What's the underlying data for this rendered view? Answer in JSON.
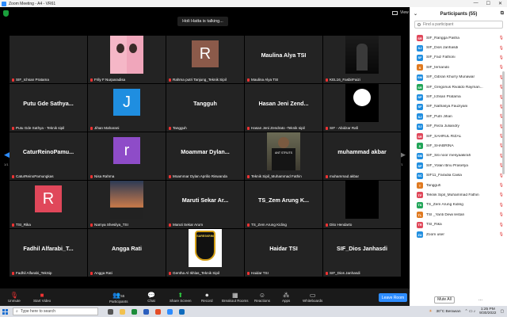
{
  "window": {
    "title": "Zoom Meeting - A4 - VR61"
  },
  "meeting": {
    "talking_indicator": "Holi Hatta is talking...",
    "view_label": "View",
    "page_left": "1/1",
    "page_right": "1/1",
    "tiles": [
      {
        "big": "",
        "cap": "SIF_Ichsan Pratama",
        "cap_name": "SIF_Ichsan Prata...",
        "kind": "name"
      },
      {
        "big": "",
        "cap": "Frily F Nurparadisa",
        "kind": "photo",
        "photo": "two-girls"
      },
      {
        "big": "",
        "cap": "Rahma putri Tanjung_Teknik Sipil",
        "kind": "avatar",
        "letter": "R",
        "color": "#8b5a4a"
      },
      {
        "big": "Maulina Alya TSI",
        "cap": "Maulina Alya TSI",
        "kind": "name"
      },
      {
        "big": "",
        "cap": "KEL16_FasbirFaizi",
        "kind": "photo",
        "photo": "dark-room"
      },
      {
        "big": "Putu Gde Sathya...",
        "cap": "Putu Gde Sathya - Teknik sipil",
        "kind": "name"
      },
      {
        "big": "",
        "cap": "Jihan Maharani",
        "kind": "avatar",
        "letter": "J",
        "color": "#1f8ee0"
      },
      {
        "big": "Tangguh",
        "cap": "Tangguh",
        "kind": "name"
      },
      {
        "big": "Hasan Jeni Zend...",
        "cap": "Hasan Jeni Zendrato -Teknik sipil",
        "kind": "name"
      },
      {
        "big": "",
        "cap": "SIF - Abidzar Rafi",
        "kind": "photo",
        "photo": "white-circle"
      },
      {
        "big": "CaturReinoPamu...",
        "cap": "CaturReinoPamungkas",
        "kind": "name"
      },
      {
        "big": "",
        "cap": "Nisa Rahma",
        "kind": "avatar",
        "letter": "r",
        "color": "#8e4cc8"
      },
      {
        "big": "Moammar Dylan...",
        "cap": "Moammar Dylan Aprilio Riswanda",
        "kind": "name"
      },
      {
        "big": "",
        "cap": "Teknik Sipil_Muhammad Fathin",
        "kind": "photo",
        "photo": "person"
      },
      {
        "big": "muhammad akbar",
        "cap": "muhammad akbar",
        "kind": "name"
      },
      {
        "big": "",
        "cap": "TSI_Rika",
        "kind": "avatar",
        "letter": "R",
        "color": "#e0475a"
      },
      {
        "big": "",
        "cap": "Namya Shesilya_TSI",
        "kind": "photo",
        "photo": "sunset"
      },
      {
        "big": "Maruti Sekar Ar...",
        "cap": "Maruti Sekar Arum",
        "kind": "name"
      },
      {
        "big": "TS_Zem Arung K...",
        "cap": "TS_Zem Arung Kiding",
        "kind": "name"
      },
      {
        "big": "",
        "cap": "Dito Hendarto",
        "kind": "photo",
        "photo": "black"
      },
      {
        "big": "Fadhil Alfarabi_T...",
        "cap": "Fadhil Alfarabi_TekSip",
        "kind": "name"
      },
      {
        "big": "Angga Rati",
        "cap": "Angga Rati",
        "kind": "name"
      },
      {
        "big": "",
        "cap": "Gentha Al Ikhlas_Teknik Sipil",
        "kind": "photo",
        "photo": "badge"
      },
      {
        "big": "Haidar TSI",
        "cap": "Haidar TSI",
        "kind": "name"
      },
      {
        "big": "SIF_Dios Janhasdi",
        "cap": "SIF_Dios Janhasdi",
        "kind": "name"
      }
    ],
    "badge_text": "SARESKRIM",
    "person_shirt": "ANT STRUTS"
  },
  "toolbar": {
    "unmute": "Unmute",
    "start_video": "Start Video",
    "participants": "Participants",
    "participants_count": "55",
    "chat": "Chat",
    "share_screen": "Share Screen",
    "record": "Record",
    "breakout": "Breakout Rooms",
    "reactions": "Reactions",
    "apps": "Apps",
    "whiteboards": "Whiteboards",
    "end": "Leave Room"
  },
  "panel": {
    "title": "Participants (55)",
    "search_placeholder": "Find a participant",
    "mute_all": "Mute All",
    "more": "...",
    "participants": [
      {
        "initials": "SR",
        "name": "SIF_Rangga Pasha",
        "color": "#e0475a"
      },
      {
        "initials": "SJ",
        "name": "SIF_Dios Janhasdi",
        "color": "#1f8ee0"
      },
      {
        "initials": "SF",
        "name": "SIF_Faiz Fathoni",
        "color": "#1f8ee0"
      },
      {
        "initials": "S",
        "name": "SIF_fernando",
        "color": "#e07a20"
      },
      {
        "initials": "SM",
        "name": "SIF_Gibran Khurry Munawar",
        "color": "#1f8ee0"
      },
      {
        "initials": "SR",
        "name": "SIF_Gregorius Rivaldo Rayman...",
        "color": "#21a558"
      },
      {
        "initials": "SP",
        "name": "SIF_Ichsan Pratama",
        "color": "#1f8ee0"
      },
      {
        "initials": "SF",
        "name": "SIF_Nathasya Fauziyani",
        "color": "#1f8ee0"
      },
      {
        "initials": "SJ",
        "name": "SIF_Putri Jihan",
        "color": "#1f8ee0"
      },
      {
        "initials": "SJ",
        "name": "SIF_Reza Juliandry",
        "color": "#1f8ee0"
      },
      {
        "initials": "SR",
        "name": "SIF_SAHRUL RIZAL",
        "color": "#e0475a"
      },
      {
        "initials": "S",
        "name": "SIF_SHABRINA",
        "color": "#21a558"
      },
      {
        "initials": "SM",
        "name": "SIF_Siti noor mesyaakirah",
        "color": "#1f8ee0"
      },
      {
        "initials": "SP",
        "name": "SIF_Yolan Ibnu Prasetya",
        "color": "#1f8ee0"
      },
      {
        "initials": "SC",
        "name": "SIF11_Faradia Caisa",
        "color": "#1f8ee0"
      },
      {
        "initials": "T",
        "name": "Tangguh",
        "color": "#e07a20"
      },
      {
        "initials": "TF",
        "name": "Teknik Sipil_Muhammad Fathin",
        "color": "#e0475a"
      },
      {
        "initials": "TK",
        "name": "TS_Zem Arung Kiding",
        "color": "#21a558"
      },
      {
        "initials": "TL",
        "name": "TSI _Yanti Dewi lestari",
        "color": "#e07a20"
      },
      {
        "initials": "TR",
        "name": "TSI_Rika",
        "color": "#e0475a"
      },
      {
        "initials": "ZU",
        "name": "Zoom user",
        "color": "#1f8ee0"
      }
    ]
  },
  "taskbar": {
    "search_placeholder": "Type here to search",
    "weather": "30°C Berawan",
    "time": "1:25 PM",
    "date": "9/30/2022"
  }
}
